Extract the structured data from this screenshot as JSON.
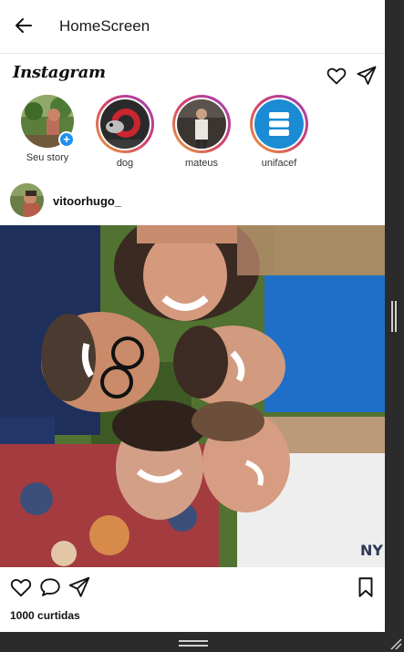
{
  "appbar": {
    "title": "HomeScreen",
    "back_icon": "arrow-left-icon"
  },
  "ig_header": {
    "logo": "Instagram",
    "icons": [
      "heart-outline-icon",
      "send-icon"
    ]
  },
  "stories": [
    {
      "label": "Seu story",
      "has_ring": false,
      "badge": "+"
    },
    {
      "label": "dog",
      "has_ring": true
    },
    {
      "label": "mateus",
      "has_ring": true
    },
    {
      "label": "unifacef",
      "has_ring": true
    }
  ],
  "post": {
    "author": "vitoorhugo_",
    "likes": "1000 curtidas",
    "action_icons": [
      "heart-outline-icon",
      "comment-icon",
      "send-icon",
      "bookmark-icon"
    ]
  },
  "colors": {
    "story_ring_start": "#e8a43b",
    "story_ring_end": "#9b3fbf",
    "badge_blue": "#1e90f0",
    "unifacef_blue": "#1b8bd4"
  }
}
